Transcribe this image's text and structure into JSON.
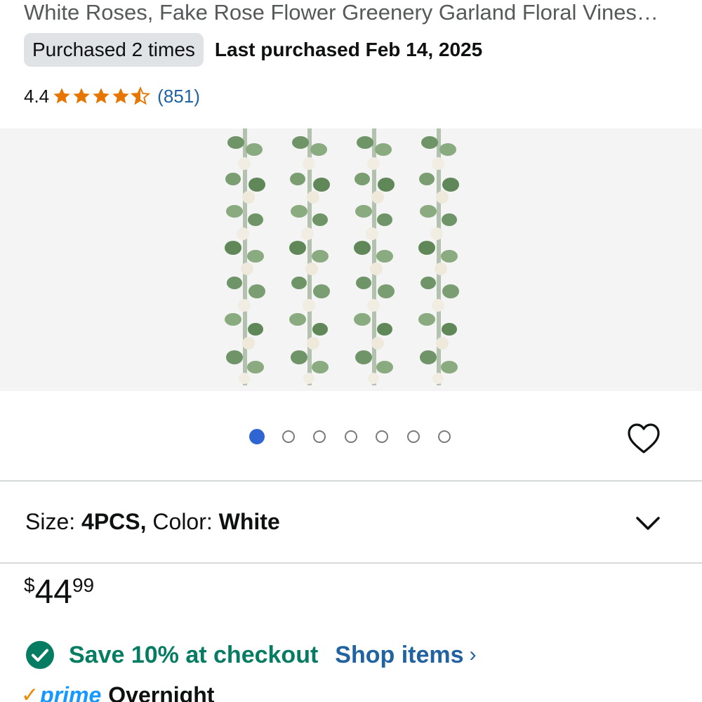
{
  "product": {
    "title": "White Roses, Fake Rose Flower Greenery Garland Floral Vines…",
    "purchased_badge": "Purchased 2 times",
    "last_purchased": "Last purchased Feb 14, 2025",
    "rating_value": "4.4",
    "rating_stars": 4.5,
    "rating_count": "(851)",
    "image_icon": "product-photo-garlands"
  },
  "gallery": {
    "total_images": 7,
    "active_index": 0
  },
  "variation": {
    "size_label": "Size: ",
    "size_value": "4PCS,",
    "color_label": " Color: ",
    "color_value": "White"
  },
  "price": {
    "symbol": "$",
    "whole": "44",
    "fraction": "99"
  },
  "promo": {
    "text": "Save 10% at checkout",
    "link": "Shop items",
    "link_chevron": "›"
  },
  "delivery": {
    "prime_label": "prime",
    "text": "Overnight"
  },
  "colors": {
    "star": "#e77600",
    "link": "#2162a1",
    "promo_green": "#067d62",
    "dot_active": "#2f64d3",
    "prime_blue": "#1399ff"
  }
}
